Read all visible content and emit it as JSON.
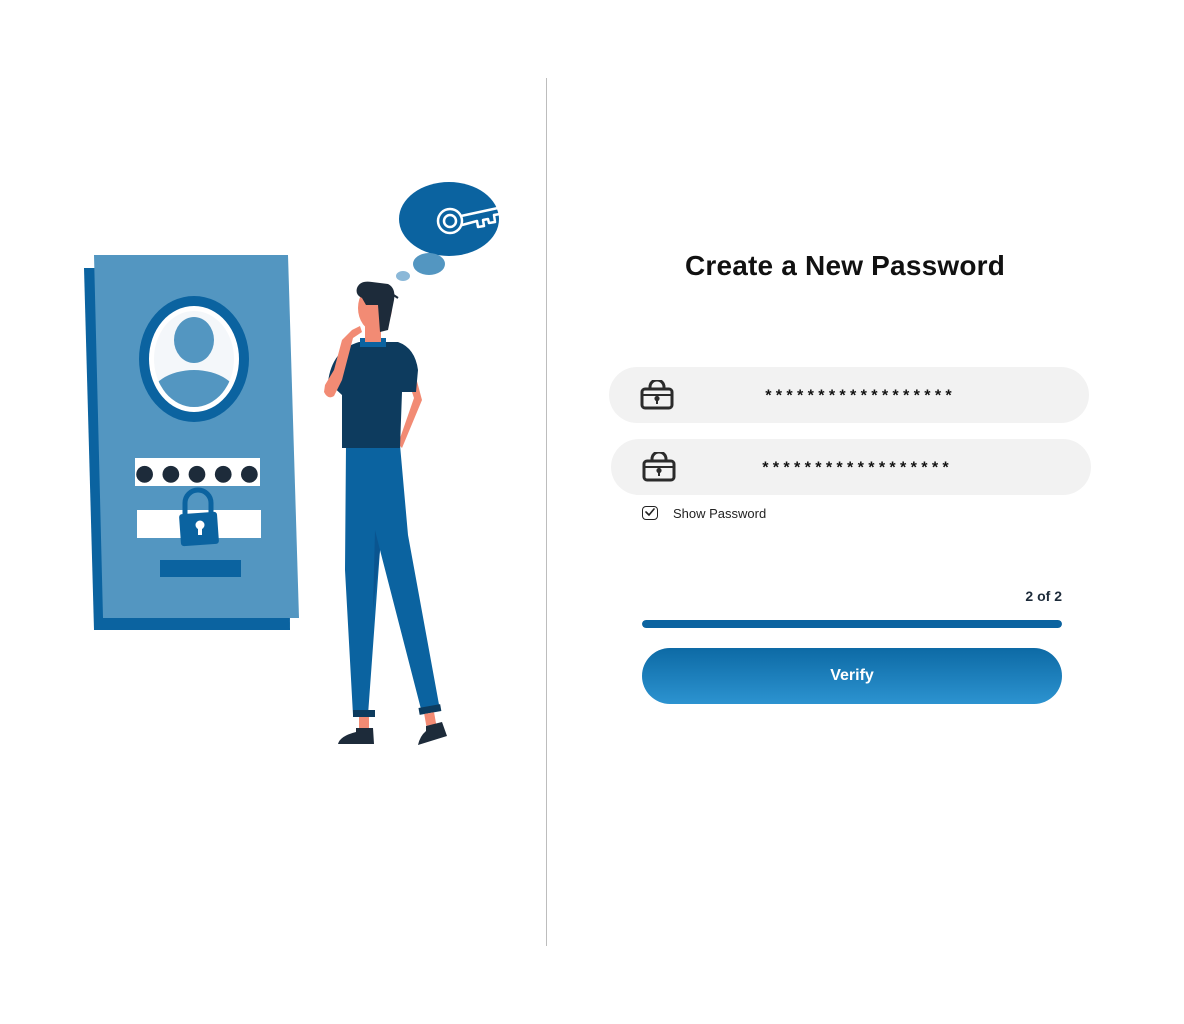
{
  "page": {
    "title": "Create a New Password"
  },
  "form": {
    "new_password": {
      "value": "******************",
      "icon": "lock-icon"
    },
    "confirm_password": {
      "value": "******************",
      "icon": "lock-icon"
    },
    "show_password": {
      "label": "Show Password",
      "checked": true
    },
    "step_label": "2 of 2",
    "progress_fraction": 1.0,
    "verify_label": "Verify"
  },
  "illustration": {
    "pin_dots": "● ● ● ● ●"
  },
  "colors": {
    "primary": "#0b63a0",
    "panel": "#5396c1",
    "field_bg": "#f2f2f2",
    "shirt": "#0d3b5e",
    "skin": "#f28b74"
  }
}
